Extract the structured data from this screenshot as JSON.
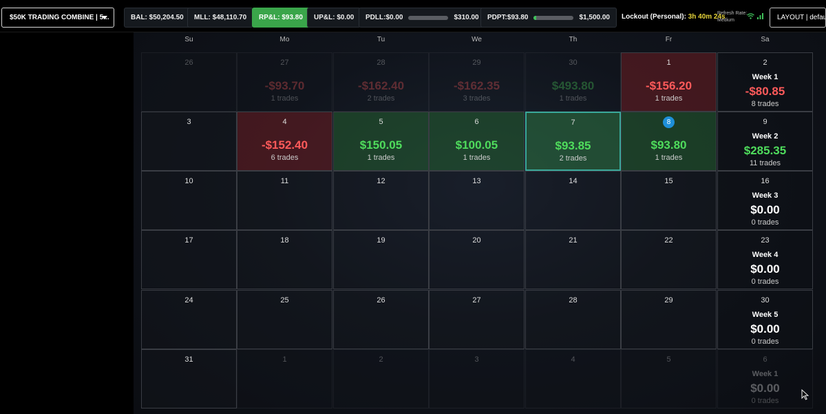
{
  "topbar": {
    "account": "$50K TRADING COMBINE | 5...",
    "bal": "BAL: $50,204.50",
    "mll": "MLL: $48,110.70",
    "rpl": "RP&L: $93.80",
    "upl": "UP&L: $0.00",
    "pdll_label": "PDLL:$0.00",
    "pdll_max": "$310.00",
    "pdll_progress": 0.0,
    "pdpt_label": "PDPT:$93.80",
    "pdpt_max": "$1,500.00",
    "pdpt_progress": 0.06,
    "lockout_label": "Lockout (Personal):",
    "lockout_time": "3h 40m 24s",
    "refresh_label": "Refresh Rate:",
    "refresh_value": "Medium",
    "layout": "LAYOUT | default"
  },
  "calendar": {
    "weekdays": [
      "Su",
      "Mo",
      "Tu",
      "We",
      "Th",
      "Fr",
      "Sa"
    ],
    "rows": [
      [
        {
          "day": "26",
          "dim": true
        },
        {
          "day": "27",
          "dim": true,
          "amount": "-$93.70",
          "trades": "1 trades",
          "tone": "neg"
        },
        {
          "day": "28",
          "dim": true,
          "amount": "-$162.40",
          "trades": "2 trades",
          "tone": "neg"
        },
        {
          "day": "29",
          "dim": true,
          "amount": "-$162.35",
          "trades": "3 trades",
          "tone": "neg"
        },
        {
          "day": "30",
          "dim": true,
          "amount": "$493.80",
          "trades": "1 trades",
          "tone": "pos"
        },
        {
          "day": "1",
          "amount": "-$156.20",
          "trades": "1 trades",
          "tone": "neg",
          "bg": "neg"
        },
        {
          "day": "2",
          "week": "Week 1",
          "amount": "-$80.85",
          "trades": "8 trades",
          "tone": "neg"
        }
      ],
      [
        {
          "day": "3"
        },
        {
          "day": "4",
          "amount": "-$152.40",
          "trades": "6 trades",
          "tone": "neg",
          "bg": "neg"
        },
        {
          "day": "5",
          "amount": "$150.05",
          "trades": "1 trades",
          "tone": "pos",
          "bg": "pos"
        },
        {
          "day": "6",
          "amount": "$100.05",
          "trades": "1 trades",
          "tone": "pos",
          "bg": "pos"
        },
        {
          "day": "7",
          "amount": "$93.85",
          "trades": "2 trades",
          "tone": "pos",
          "bg": "sel"
        },
        {
          "day": "8",
          "today": true,
          "amount": "$93.80",
          "trades": "1 trades",
          "tone": "pos",
          "bg": "pos"
        },
        {
          "day": "9",
          "week": "Week 2",
          "amount": "$285.35",
          "trades": "11 trades",
          "tone": "pos"
        }
      ],
      [
        {
          "day": "10"
        },
        {
          "day": "11"
        },
        {
          "day": "12"
        },
        {
          "day": "13"
        },
        {
          "day": "14"
        },
        {
          "day": "15"
        },
        {
          "day": "16",
          "week": "Week 3",
          "amount": "$0.00",
          "trades": "0 trades",
          "tone": "wht"
        }
      ],
      [
        {
          "day": "17"
        },
        {
          "day": "18"
        },
        {
          "day": "19"
        },
        {
          "day": "20"
        },
        {
          "day": "21"
        },
        {
          "day": "22"
        },
        {
          "day": "23",
          "week": "Week 4",
          "amount": "$0.00",
          "trades": "0 trades",
          "tone": "wht"
        }
      ],
      [
        {
          "day": "24"
        },
        {
          "day": "25"
        },
        {
          "day": "26"
        },
        {
          "day": "27"
        },
        {
          "day": "28"
        },
        {
          "day": "29"
        },
        {
          "day": "30",
          "week": "Week 5",
          "amount": "$0.00",
          "trades": "0 trades",
          "tone": "wht"
        }
      ],
      [
        {
          "day": "31"
        },
        {
          "day": "1",
          "dim": true
        },
        {
          "day": "2",
          "dim": true
        },
        {
          "day": "3",
          "dim": true
        },
        {
          "day": "4",
          "dim": true
        },
        {
          "day": "5",
          "dim": true
        },
        {
          "day": "6",
          "dim": true,
          "week": "Week 1",
          "amount": "$0.00",
          "trades": "0 trades",
          "tone": "wht"
        }
      ]
    ]
  }
}
